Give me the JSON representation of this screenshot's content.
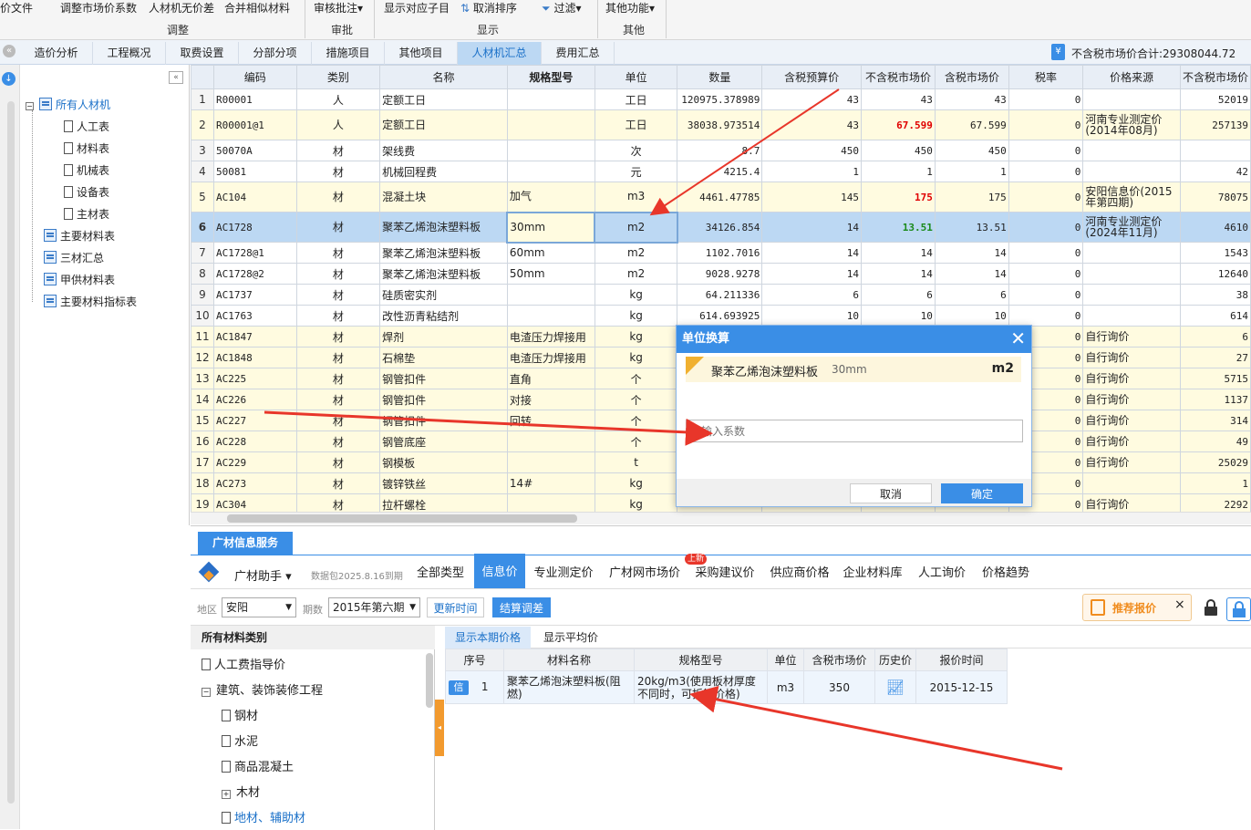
{
  "ribbon": {
    "items": [
      "价文件",
      "调整市场价系数",
      "人材机无价差",
      "合并相似材料",
      "审核批注",
      "显示对应子目",
      "取消排序",
      "过滤",
      "其他功能"
    ],
    "groups": [
      "调整",
      "审批",
      "显示",
      "其他"
    ]
  },
  "tabs": [
    "造价分析",
    "工程概况",
    "取费设置",
    "分部分项",
    "措施项目",
    "其他项目",
    "人材机汇总",
    "费用汇总"
  ],
  "total": "不含税市场价合计:29308044.72",
  "tree": [
    "所有人材机",
    "人工表",
    "材料表",
    "机械表",
    "设备表",
    "主材表",
    "主要材料表",
    "三材汇总",
    "甲供材料表",
    "主要材料指标表"
  ],
  "grid": {
    "headers": [
      "",
      "编码",
      "类别",
      "名称",
      "规格型号",
      "单位",
      "数量",
      "含税预算价",
      "不含税市场价",
      "含税市场价",
      "税率",
      "价格来源",
      "不含税市场价"
    ],
    "rows": [
      [
        "1",
        "R00001",
        "人",
        "定额工日",
        "",
        "工日",
        "120975.378989",
        "43",
        "43",
        "43",
        "0",
        "",
        "52019"
      ],
      [
        "2",
        "R00001@1",
        "人",
        "定额工日",
        "",
        "工日",
        "38038.973514",
        "43",
        "67.599",
        "67.599",
        "0",
        "河南专业测定价(2014年08月)",
        "257139"
      ],
      [
        "3",
        "50070A",
        "材",
        "架线费",
        "",
        "次",
        "8.7",
        "450",
        "450",
        "450",
        "0",
        "",
        ""
      ],
      [
        "4",
        "50081",
        "材",
        "机械回程费",
        "",
        "元",
        "4215.4",
        "1",
        "1",
        "1",
        "0",
        "",
        "42"
      ],
      [
        "5",
        "AC104",
        "材",
        "混凝土块",
        "加气",
        "m3",
        "4461.47785",
        "145",
        "175",
        "175",
        "0",
        "安阳信息价(2015年第四期)",
        "78075"
      ],
      [
        "6",
        "AC1728",
        "材",
        "聚苯乙烯泡沫塑料板",
        "30mm",
        "m2",
        "34126.854",
        "14",
        "13.51",
        "13.51",
        "0",
        "河南专业测定价(2024年11月)",
        "4610"
      ],
      [
        "7",
        "AC1728@1",
        "材",
        "聚苯乙烯泡沫塑料板",
        "60mm",
        "m2",
        "1102.7016",
        "14",
        "14",
        "14",
        "0",
        "",
        "1543"
      ],
      [
        "8",
        "AC1728@2",
        "材",
        "聚苯乙烯泡沫塑料板",
        "50mm",
        "m2",
        "9028.9278",
        "14",
        "14",
        "14",
        "0",
        "",
        "12640"
      ],
      [
        "9",
        "AC1737",
        "材",
        "硅质密实剂",
        "",
        "kg",
        "64.211336",
        "6",
        "6",
        "6",
        "0",
        "",
        "38"
      ],
      [
        "10",
        "AC1763",
        "材",
        "改性沥青粘结剂",
        "",
        "kg",
        "614.693925",
        "10",
        "10",
        "10",
        "0",
        "",
        "614"
      ],
      [
        "11",
        "AC1847",
        "材",
        "焊剂",
        "电渣压力焊接用",
        "kg",
        "",
        "",
        "",
        "",
        "0",
        "自行询价",
        "6"
      ],
      [
        "12",
        "AC1848",
        "材",
        "石棉垫",
        "电渣压力焊接用",
        "kg",
        "",
        "",
        "",
        "",
        "0",
        "自行询价",
        "27"
      ],
      [
        "13",
        "AC225",
        "材",
        "钢管扣件",
        "直角",
        "个",
        "",
        "",
        "",
        "",
        "0",
        "自行询价",
        "5715"
      ],
      [
        "14",
        "AC226",
        "材",
        "钢管扣件",
        "对接",
        "个",
        "",
        "",
        "",
        "",
        "0",
        "自行询价",
        "1137"
      ],
      [
        "15",
        "AC227",
        "材",
        "钢管扣件",
        "回转",
        "个",
        "",
        "",
        "",
        "",
        "0",
        "自行询价",
        "314"
      ],
      [
        "16",
        "AC228",
        "材",
        "钢管底座",
        "",
        "个",
        "",
        "",
        "",
        "",
        "0",
        "自行询价",
        "49"
      ],
      [
        "17",
        "AC229",
        "材",
        "钢模板",
        "",
        "t",
        "",
        "",
        "",
        "",
        "0",
        "自行询价",
        "25029"
      ],
      [
        "18",
        "AC273",
        "材",
        "镀锌铁丝",
        "14#",
        "kg",
        "",
        "",
        "",
        "",
        "0",
        "",
        "1"
      ],
      [
        "19",
        "AC304",
        "材",
        "拉杆螺栓",
        "",
        "kg",
        "",
        "",
        "",
        "",
        "0",
        "自行询价",
        "2292"
      ]
    ]
  },
  "bottom": {
    "title": "广材信息服务",
    "assistant": "广材助手",
    "pkg": "数据包2025.8.16到期",
    "tabs": [
      "全部类型",
      "信息价",
      "专业测定价",
      "广材网市场价",
      "采购建议价",
      "供应商价格",
      "企业材料库",
      "人工询价",
      "价格趋势"
    ],
    "new_badge": "上新",
    "region_label": "地区",
    "region": "安阳",
    "period_label": "期数",
    "period": "2015年第六期",
    "update": "更新时间",
    "settle": "结算调差",
    "recommend": "推荐报价",
    "cat_title": "所有材料类别",
    "cats": [
      "人工费指导价",
      "建筑、装饰装修工程",
      "钢材",
      "水泥",
      "商品混凝土",
      "木材",
      "地材、辅助材"
    ],
    "subtabs": [
      "显示本期价格",
      "显示平均价"
    ],
    "headers": [
      "序号",
      "材料名称",
      "规格型号",
      "单位",
      "含税市场价",
      "历史价",
      "报价时间"
    ],
    "row": {
      "tag": "信",
      "no": "1",
      "name": "聚苯乙烯泡沫塑料板(阻燃)",
      "spec": "20kg/m3(使用板材厚度不同时，可折算价格)",
      "unit": "m3",
      "price": "350",
      "time": "2015-12-15"
    }
  },
  "dialog": {
    "title": "单位换算",
    "mat": "聚苯乙烯泡沫塑料板",
    "spec": "30mm",
    "unit": "m2",
    "placeholder": "请输入系数",
    "cancel": "取消",
    "ok": "确定"
  },
  "colors": {
    "accent": "#3a8ee6",
    "red": "#e00000",
    "green": "#1a8a1a",
    "arrow": "#e8362a"
  }
}
